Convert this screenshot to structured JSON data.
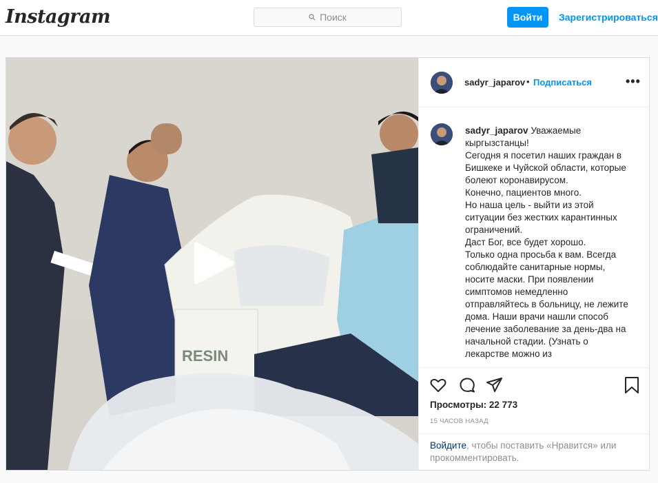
{
  "header": {
    "logo": "Instagram",
    "search_placeholder": "Поиск",
    "login_label": "Войти",
    "signup_label": "Зарегистрироваться"
  },
  "post": {
    "author": "sadyr_japarov",
    "dot": "•",
    "follow_label": "Подписаться",
    "more_label": "•••",
    "caption_username": "sadyr_japarov",
    "caption_lines": [
      "Уважаемые кыргызстанцы!",
      "Сегодня я посетил наших граждан в Бишкеке и Чуйской области, которые болеют коронавирусом.",
      "Конечно, пациентов много.",
      "Но наша цель - выйти из этой ситуации без жестких карантинных ограничений.",
      "Даст Бог, все будет хорошо.",
      "Только одна просьба к вам. Всегда соблюдайте санитарные нормы, носите маски. При появлении симптомов немедленно отправляйтесь в больницу, не лежите дома. Наши врачи нашли способ лечение заболевание за день-два на начальной стадии. (Узнать о лекарстве можно из"
    ],
    "views_label": "Просмотры: 22 773",
    "time_label": "15 ЧАСОВ НАЗАД",
    "login_link": "Войдите",
    "login_rest": ", чтобы поставить «Нравится» или прокомментировать.",
    "video_bag_text": "RESIN"
  },
  "icons": {
    "search": "search-icon",
    "like": "heart-icon",
    "comment": "comment-icon",
    "share": "paper-plane-icon",
    "save": "bookmark-icon",
    "play": "play-icon"
  },
  "colors": {
    "accent": "#0095f6",
    "link_dark": "#00376b",
    "border": "#dbdbdb"
  }
}
